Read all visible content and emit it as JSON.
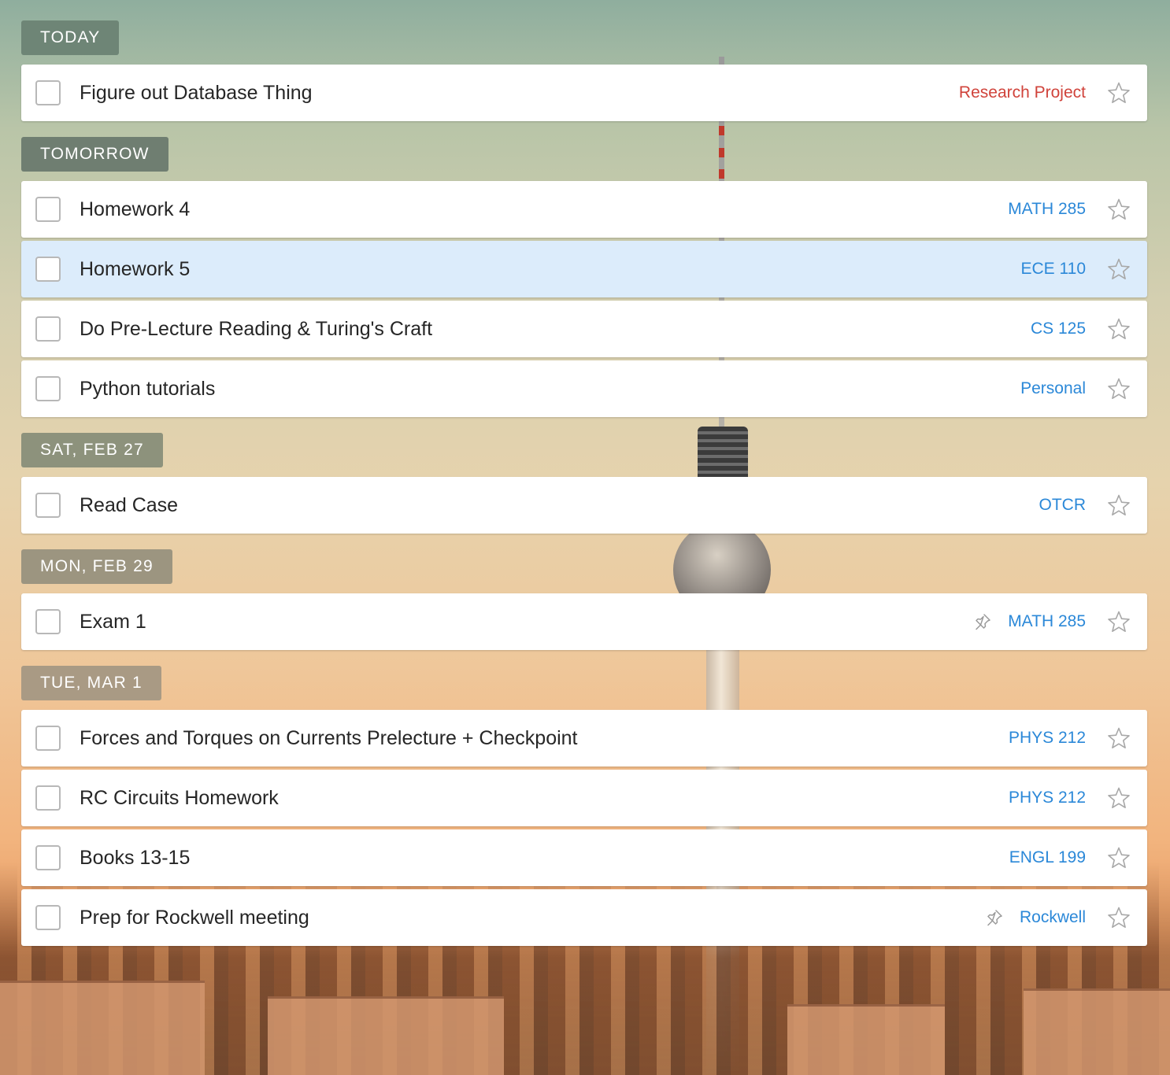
{
  "colors": {
    "list_label_blue": "#2b88d8",
    "list_label_red": "#d0433b",
    "selected_row": "#dcecfb",
    "header_today": "#6e8576",
    "header_tomorrow": "#6f7e71",
    "header_sat": "#8d927c",
    "header_mon": "#9c9580",
    "header_tue": "#a99a84"
  },
  "icons": {
    "checkbox": "checkbox-icon",
    "star": "star-outline-icon",
    "pin": "pin-icon"
  },
  "sections": [
    {
      "header": "TODAY",
      "tasks": [
        {
          "title": "Figure out Database Thing",
          "list": "Research Project"
        }
      ]
    },
    {
      "header": "TOMORROW",
      "tasks": [
        {
          "title": "Homework 4",
          "list": "MATH 285"
        },
        {
          "title": "Homework 5",
          "list": "ECE 110",
          "selected": true
        },
        {
          "title": "Do Pre-Lecture Reading & Turing's Craft",
          "list": "CS 125"
        },
        {
          "title": "Python tutorials",
          "list": "Personal"
        }
      ]
    },
    {
      "header": "SAT, FEB 27",
      "tasks": [
        {
          "title": "Read Case",
          "list": "OTCR"
        }
      ]
    },
    {
      "header": "MON, FEB 29",
      "tasks": [
        {
          "title": "Exam 1",
          "list": "MATH 285",
          "pinned": true
        }
      ]
    },
    {
      "header": "TUE, MAR 1",
      "tasks": [
        {
          "title": "Forces and Torques on Currents Prelecture + Checkpoint",
          "list": "PHYS 212"
        },
        {
          "title": "RC Circuits Homework",
          "list": "PHYS 212"
        },
        {
          "title": "Books 13-15",
          "list": "ENGL 199"
        },
        {
          "title": "Prep for Rockwell meeting",
          "list": "Rockwell",
          "pinned": true
        }
      ]
    }
  ]
}
